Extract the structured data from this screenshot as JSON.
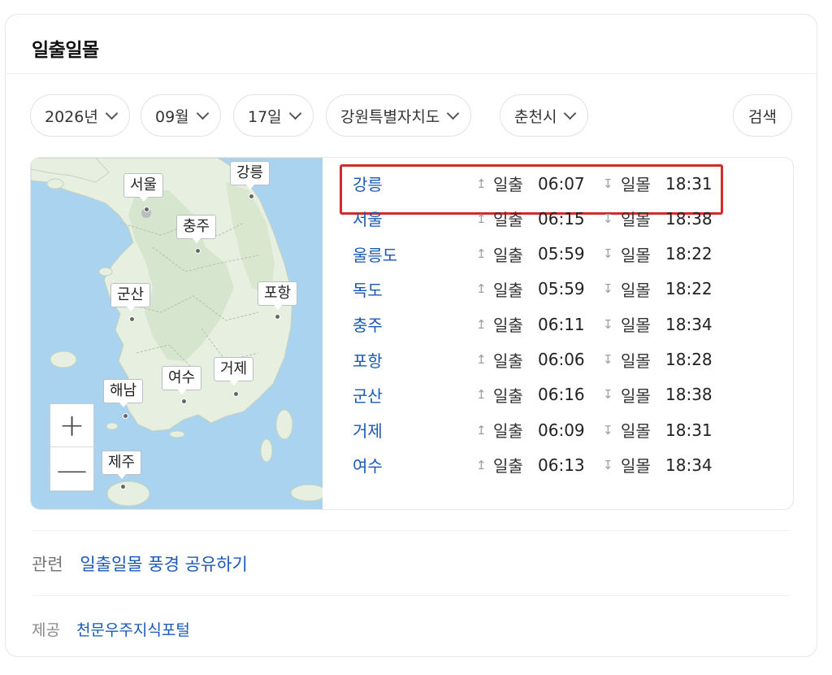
{
  "card": {
    "title": "일출일몰"
  },
  "filters": {
    "year": "2026년",
    "month": "09월",
    "day": "17일",
    "province": "강원특별자치도",
    "city": "춘천시",
    "search_label": "검색"
  },
  "map": {
    "labels": [
      "서울",
      "강릉",
      "충주",
      "군산",
      "포항",
      "거제",
      "여수",
      "해남",
      "제주"
    ],
    "zoom_in": "+",
    "zoom_out": "—"
  },
  "times": {
    "sunrise_label": "일출",
    "sunset_label": "일몰",
    "sunrise_icon": "↥",
    "sunset_icon": "↧",
    "rows": [
      {
        "city": "강릉",
        "sunrise": "06:07",
        "sunset": "18:31"
      },
      {
        "city": "서울",
        "sunrise": "06:15",
        "sunset": "18:38"
      },
      {
        "city": "울릉도",
        "sunrise": "05:59",
        "sunset": "18:22"
      },
      {
        "city": "독도",
        "sunrise": "05:59",
        "sunset": "18:22"
      },
      {
        "city": "충주",
        "sunrise": "06:11",
        "sunset": "18:34"
      },
      {
        "city": "포항",
        "sunrise": "06:06",
        "sunset": "18:28"
      },
      {
        "city": "군산",
        "sunrise": "06:16",
        "sunset": "18:38"
      },
      {
        "city": "거제",
        "sunrise": "06:09",
        "sunset": "18:31"
      },
      {
        "city": "여수",
        "sunrise": "06:13",
        "sunset": "18:34"
      }
    ]
  },
  "related": {
    "label": "관련",
    "link": "일출일몰 풍경 공유하기"
  },
  "provider": {
    "label": "제공",
    "link": "천문우주지식포털"
  }
}
